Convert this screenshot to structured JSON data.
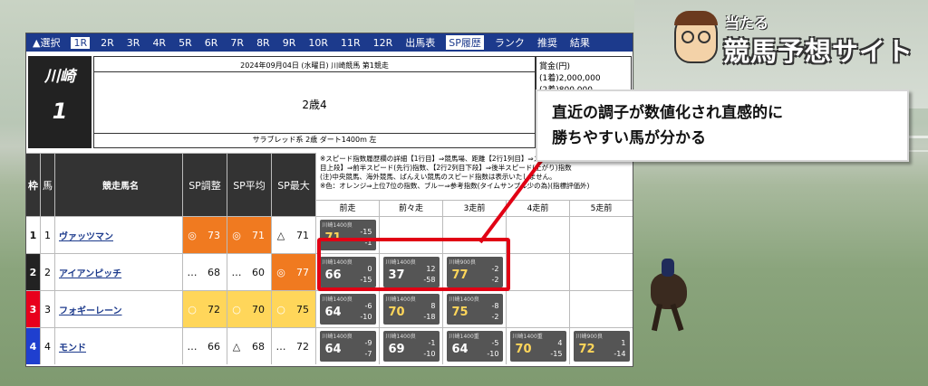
{
  "site": {
    "top": "当たる",
    "main": "競馬予想サイト"
  },
  "callout": {
    "line1": "直近の調子が数値化され直感的に",
    "line2": "勝ちやすい馬が分かる"
  },
  "nav": {
    "items": [
      "▲選択",
      "1R",
      "2R",
      "3R",
      "4R",
      "5R",
      "6R",
      "7R",
      "8R",
      "9R",
      "10R",
      "11R",
      "12R",
      "出馬表",
      "SP履歴",
      "ランク",
      "推奨",
      "結果"
    ],
    "selected": [
      1,
      14
    ]
  },
  "race": {
    "venue": "川崎",
    "number": "1",
    "date": "2024年09月04日 (水曜日) 川崎競馬 第1競走",
    "title": "2歳4",
    "cond": "サラブレッド系 2歳 ダート1400m 左"
  },
  "prize": {
    "label": "賞金(円)",
    "first": "(1着)2,000,000",
    "second": "(2着)800,000"
  },
  "header": {
    "waku": "枠",
    "uma": "馬",
    "name": "競走馬名",
    "sp1": "SP調整",
    "sp2": "SP平均",
    "sp3": "SP最大",
    "r1": "前走",
    "r2": "前々走",
    "r3": "3走前",
    "r4": "4走前",
    "r5": "5走前"
  },
  "note": [
    "※スピード指数履歴欄の詳細【1行目】⇒競馬場、距離【2行1列目】⇒スピード指数",
    "目上段】⇒前半スピード(先行)指数、【2行2列目下段】⇒後半スピード(上がり)指数",
    "(注)中央競馬、海外競馬、ばんえい競馬のスピード指数は表示いたしません。",
    "※色：オレンジ⇒上位7位の指数、ブルー⇒参考指数(タイムサンプル少の為)(指標評価外)"
  ],
  "horses": [
    {
      "waku": "1",
      "uma": "1",
      "name": "ヴァッツマン",
      "sp": [
        {
          "m": "◎",
          "v": "73"
        },
        {
          "m": "◎",
          "v": "71"
        },
        {
          "m": "△",
          "v": "71"
        }
      ],
      "runs": [
        {
          "lbl": "川崎1400良",
          "big": "71",
          "a1": "-15",
          "a2": "-1"
        },
        null,
        null,
        null,
        null
      ]
    },
    {
      "waku": "2",
      "uma": "2",
      "name": "アイアンピッチ",
      "sp": [
        {
          "m": "…",
          "v": "68"
        },
        {
          "m": "…",
          "v": "60"
        },
        {
          "m": "◎",
          "v": "77"
        }
      ],
      "runs": [
        {
          "lbl": "川崎1400良",
          "big": "66",
          "a1": "0",
          "a2": "-15"
        },
        {
          "lbl": "川崎1400良",
          "big": "37",
          "a1": "12",
          "a2": "-58"
        },
        {
          "lbl": "川崎900良",
          "big": "77",
          "a1": "-2",
          "a2": "-2"
        },
        null,
        null
      ]
    },
    {
      "waku": "3",
      "uma": "3",
      "name": "フォギーレーン",
      "sp": [
        {
          "m": "○",
          "v": "72"
        },
        {
          "m": "○",
          "v": "70"
        },
        {
          "m": "○",
          "v": "75"
        }
      ],
      "runs": [
        {
          "lbl": "川崎1400良",
          "big": "64",
          "a1": "-6",
          "a2": "-10"
        },
        {
          "lbl": "川崎1400良",
          "big": "70",
          "a1": "8",
          "a2": "-18"
        },
        {
          "lbl": "川崎1400良",
          "big": "75",
          "a1": "-8",
          "a2": "-2"
        },
        null,
        null
      ]
    },
    {
      "waku": "4",
      "uma": "4",
      "name": "モンド",
      "sp": [
        {
          "m": "…",
          "v": "66"
        },
        {
          "m": "△",
          "v": "68"
        },
        {
          "m": "…",
          "v": "72"
        }
      ],
      "runs": [
        {
          "lbl": "川崎1400良",
          "big": "64",
          "a1": "-9",
          "a2": "-7"
        },
        {
          "lbl": "川崎1400良",
          "big": "69",
          "a1": "-1",
          "a2": "-10"
        },
        {
          "lbl": "川崎1400重",
          "big": "64",
          "a1": "-5",
          "a2": "-10"
        },
        {
          "lbl": "川崎1400重",
          "big": "70",
          "a1": "4",
          "a2": "-15"
        },
        {
          "lbl": "川崎900良",
          "big": "72",
          "a1": "1",
          "a2": "-14"
        }
      ]
    }
  ],
  "colors": {
    "waku": [
      "#ffffff",
      "#222222",
      "#e8001c",
      "#1f3fcf"
    ],
    "orange": "#f07a20",
    "yellow": "#ffd65a",
    "accent": "#e10014"
  }
}
